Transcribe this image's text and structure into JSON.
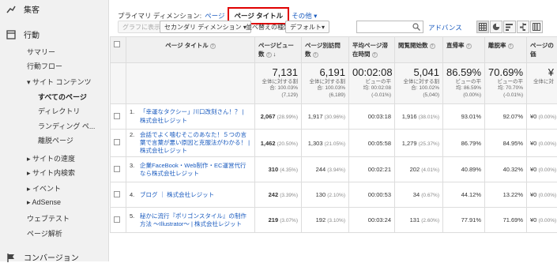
{
  "sidebar": {
    "audience": "集客",
    "behavior": "行動",
    "items": [
      "サマリー",
      "行動フロー",
      "サイト コンテンツ",
      "すべてのページ",
      "ディレクトリ",
      "ランディング ペ...",
      "離脱ページ",
      "サイトの速度",
      "サイト内検索",
      "イベント",
      "AdSense",
      "ウェブテスト",
      "ページ解析"
    ],
    "conversion": "コンバージョン"
  },
  "toolbar": {
    "primary_label": "プライマリ ディメンション:",
    "page_link": "ページ",
    "page_title_selected": "ページ タイトル",
    "other": "その他"
  },
  "controls": {
    "graph_btn": "グラフに表示",
    "secondary_btn": "セカンダリ ディメンション",
    "sort_label": "並べ替えの種類:",
    "sort_value": "デフォルト",
    "advanced": "アドバンス"
  },
  "headers": {
    "title": "ページ タイトル",
    "pageviews": "ページビュー数",
    "unique": "ページ別訪問数",
    "avg_time": "平均ページ滞在時間",
    "entrances": "閲覧開始数",
    "bounce": "直帰率",
    "exit": "離脱率",
    "value": "ページの価"
  },
  "totals": {
    "pageviews": "7,131",
    "pageviews_sub1": "全体に対する割",
    "pageviews_sub2": "合: 100.03%",
    "pageviews_sub3": "(7,129)",
    "unique": "6,191",
    "unique_sub1": "全体に対する割",
    "unique_sub2": "合: 100.03%",
    "unique_sub3": "(6,189)",
    "avg_time": "00:02:08",
    "avg_sub1": "ビューの平",
    "avg_sub2": "均: 00:02:08",
    "avg_sub3": "(-0.01%)",
    "entrances": "5,041",
    "ent_sub1": "全体に対する割",
    "ent_sub2": "合: 100.02%",
    "ent_sub3": "(5,040)",
    "bounce": "86.59%",
    "bounce_sub1": "ビューの平",
    "bounce_sub2": "均: 86.59%",
    "bounce_sub3": "(0.00%)",
    "exit": "70.69%",
    "exit_sub1": "ビューの平",
    "exit_sub2": "均: 70.70%",
    "exit_sub3": "(-0.01%)",
    "value": "¥",
    "value_sub1": "全体に対"
  },
  "rows": [
    {
      "idx": "1.",
      "title": "「幸運なタクシー」川口改刻さん！？ | 株式会社レジット",
      "pv": "2,067",
      "pvp": "(28.99%)",
      "uv": "1,917",
      "uvp": "(30.96%)",
      "time": "00:03:18",
      "ent": "1,916",
      "entp": "(38.01%)",
      "bounce": "93.01%",
      "exit": "92.07%",
      "val": "¥0",
      "valp": "(0.00%)"
    },
    {
      "idx": "2.",
      "title": "会話でよく噛むそこのあなた！５つの言葉で言葉が悪い原因と克服法がわかる！ | 株式会社レジット",
      "pv": "1,462",
      "pvp": "(20.50%)",
      "uv": "1,303",
      "uvp": "(21.05%)",
      "time": "00:05:58",
      "ent": "1,279",
      "entp": "(25.37%)",
      "bounce": "86.79%",
      "exit": "84.95%",
      "val": "¥0",
      "valp": "(0.00%)"
    },
    {
      "idx": "3.",
      "title": "企業FaceBook・Web制作・EC運営代行なら株式会社レジット",
      "pv": "310",
      "pvp": "(4.35%)",
      "uv": "244",
      "uvp": "(3.94%)",
      "time": "00:02:21",
      "ent": "202",
      "entp": "(4.01%)",
      "bounce": "40.89%",
      "exit": "40.32%",
      "val": "¥0",
      "valp": "(0.00%)"
    },
    {
      "idx": "4.",
      "title": "ブログ ｜ 株式会社レジット",
      "pv": "242",
      "pvp": "(3.39%)",
      "uv": "130",
      "uvp": "(2.10%)",
      "time": "00:00:53",
      "ent": "34",
      "entp": "(0.67%)",
      "bounce": "44.12%",
      "exit": "13.22%",
      "val": "¥0",
      "valp": "(0.00%)"
    },
    {
      "idx": "5.",
      "title": "秘かに流行『ポリゴンスタイル』の制作方法 〜Illustrator〜 | 株式会社レジット",
      "pv": "219",
      "pvp": "(3.07%)",
      "uv": "192",
      "uvp": "(3.10%)",
      "time": "00:03:24",
      "ent": "131",
      "entp": "(2.60%)",
      "bounce": "77.91%",
      "exit": "71.69%",
      "val": "¥0",
      "valp": "(0.00%)"
    }
  ]
}
